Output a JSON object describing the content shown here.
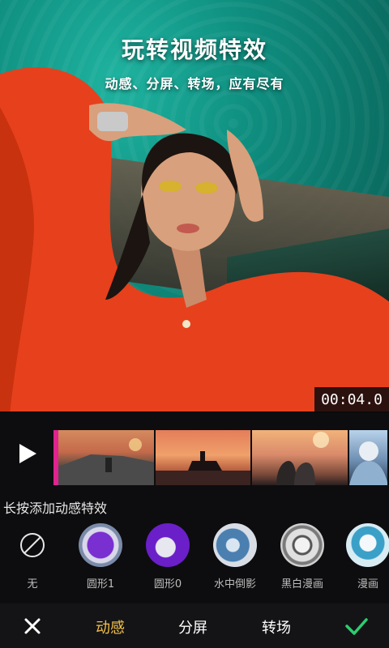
{
  "hero": {
    "title": "玩转视频特效",
    "subtitle": "动感、分屏、转场，应有尽有",
    "timecode": "00:04.0"
  },
  "timeline": {
    "play_icon": "play-icon",
    "thumbnails": [
      "thumb-road-sunset",
      "thumb-car-silhouette",
      "thumb-couple-fireworks",
      "thumb-winter-portrait"
    ]
  },
  "effects": {
    "hint": "长按添加动感特效",
    "items": [
      {
        "label": "无",
        "icon": "none-icon"
      },
      {
        "label": "圆形1",
        "icon": "round1-icon"
      },
      {
        "label": "圆形0",
        "icon": "round0-icon"
      },
      {
        "label": "水中倒影",
        "icon": "water-reflection-icon"
      },
      {
        "label": "黑白漫画",
        "icon": "bw-comic-icon"
      },
      {
        "label": "漫画",
        "icon": "comic-icon"
      }
    ]
  },
  "bottom_bar": {
    "tabs": [
      "动感",
      "分屏",
      "转场"
    ],
    "active_tab": "动感",
    "close_icon": "close-icon",
    "confirm_icon": "check-icon"
  },
  "colors": {
    "accent": "#f3c04a",
    "marker": "#e0238e",
    "confirm": "#2ecc71"
  }
}
